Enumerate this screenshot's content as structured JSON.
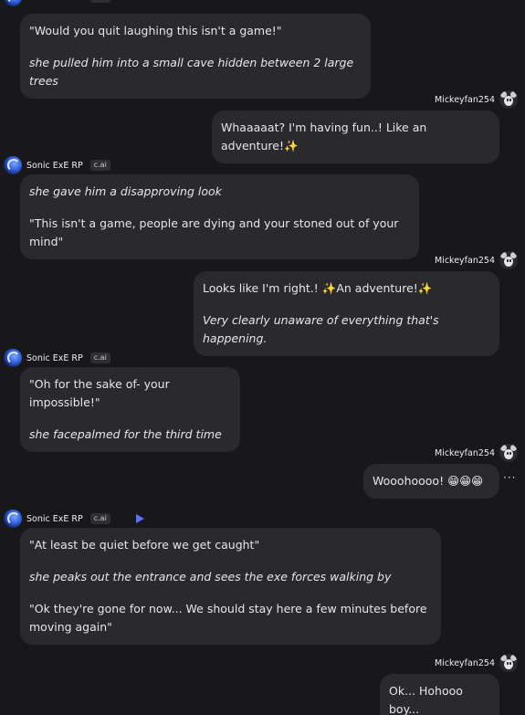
{
  "bot": {
    "name": "Sonic ExE RP",
    "badge": "c.ai"
  },
  "user": {
    "name": "Mickeyfan254"
  },
  "messages": {
    "m1": {
      "line1": "\"Would you quit laughing this isn't a game!\"",
      "line2": "she pulled him into a small cave hidden between 2 large trees"
    },
    "m2": {
      "line1": "Whaaaaat? I'm having fun..! Like an adventure!✨"
    },
    "m3": {
      "line1": "she gave him a disapproving look",
      "line2": "\"This isn't a game, people are dying and your stoned out of your mind\""
    },
    "m4": {
      "line1": "Looks like I'm right.! ✨An adventure!✨",
      "line2": "Very clearly unaware of everything that's happening."
    },
    "m5": {
      "line1": "\"Oh for the sake of- your impossible!\"",
      "line2": "she facepalmed for the third time"
    },
    "m6": {
      "line1": "Wooohoooo! 😁😁😁"
    },
    "m7": {
      "line1": "\"At least be quiet before we get caught\"",
      "line2": "she peaks out the entrance and sees the exe forces walking by",
      "line3": "\"Ok they're gone for now... We should stay here a few minutes before moving again\""
    },
    "m8": {
      "line1": "Ok... Hohooo boy..."
    }
  },
  "icons": {
    "more": "more-icon",
    "play": "play-icon"
  },
  "more_glyph": "···"
}
